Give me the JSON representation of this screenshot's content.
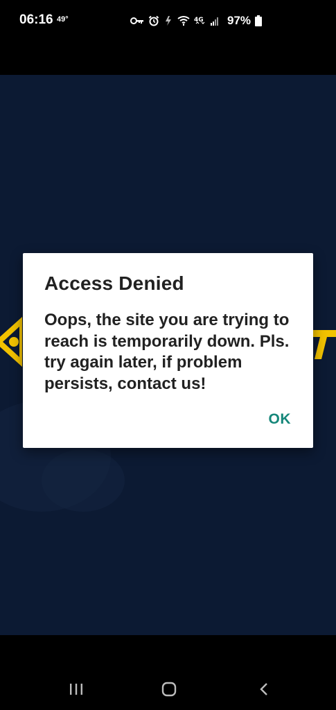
{
  "status_bar": {
    "time": "06:16",
    "temperature": "49°",
    "battery_percent": "97%",
    "icons": [
      "vpn-key-icon",
      "alarm-icon",
      "data-saver-icon",
      "wifi-icon",
      "4g-icon",
      "signal-icon",
      "battery-icon"
    ]
  },
  "dialog": {
    "title": "Access Denied",
    "message": "Oops, the site you are trying to reach is temporarily down. Pls. try again later, if problem persists, contact us!",
    "ok_label": "OK",
    "accent_color": "#16877a"
  },
  "navigation_bar": {
    "buttons": [
      "recent-apps-icon",
      "home-icon",
      "back-icon"
    ]
  },
  "colors": {
    "app_background": "#0c1a33",
    "logo_yellow": "#f2c200"
  }
}
